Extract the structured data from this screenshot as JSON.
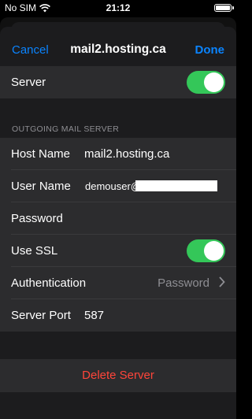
{
  "status": {
    "carrier": "No SIM",
    "time": "21:12"
  },
  "nav": {
    "cancel": "Cancel",
    "title": "mail2.hosting.ca",
    "done": "Done"
  },
  "incoming": {
    "server_label": "Server",
    "server_on": true
  },
  "outgoing": {
    "header": "OUTGOING MAIL SERVER",
    "host_label": "Host Name",
    "host_value": "mail2.hosting.ca",
    "user_label": "User Name",
    "user_value": "demouser@",
    "password_label": "Password",
    "ssl_label": "Use SSL",
    "ssl_on": true,
    "auth_label": "Authentication",
    "auth_value": "Password",
    "port_label": "Server Port",
    "port_value": "587"
  },
  "delete_label": "Delete Server",
  "colors": {
    "accent": "#0a84ff",
    "toggle_on": "#34c759",
    "destructive": "#ff453a"
  },
  "icons": {
    "wifi": "wifi-icon",
    "battery": "battery-icon",
    "chevron": "chevron-right-icon"
  }
}
